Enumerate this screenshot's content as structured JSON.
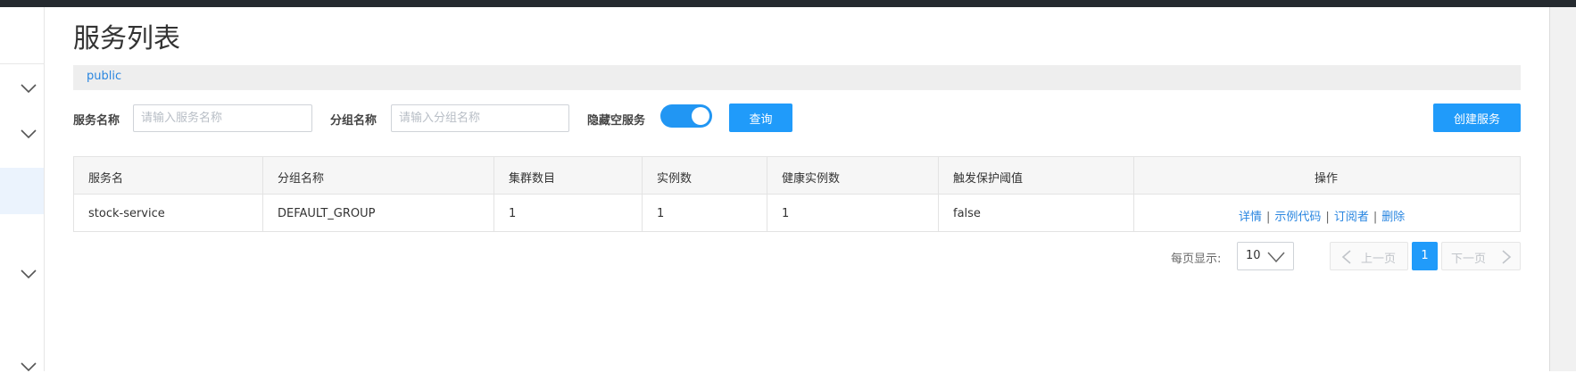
{
  "page": {
    "title": "服务列表"
  },
  "namespace": {
    "label": "public"
  },
  "filters": {
    "service_name_label": "服务名称",
    "service_name_placeholder": "请输入服务名称",
    "group_name_label": "分组名称",
    "group_name_placeholder": "请输入分组名称",
    "hide_empty_label": "隐藏空服务",
    "hide_empty_on": true,
    "query_button": "查询",
    "create_button": "创建服务"
  },
  "table": {
    "headers": [
      "服务名",
      "分组名称",
      "集群数目",
      "实例数",
      "健康实例数",
      "触发保护阈值",
      "操作"
    ],
    "rows": [
      {
        "service_name": "stock-service",
        "group_name": "DEFAULT_GROUP",
        "cluster_count": "1",
        "instance_count": "1",
        "healthy_instance_count": "1",
        "protect_threshold": "false",
        "ops": {
          "detail": "详情",
          "sample_code": "示例代码",
          "subscribers": "订阅者",
          "delete": "删除",
          "separator": "|"
        }
      }
    ]
  },
  "pagination": {
    "page_size_label": "每页显示:",
    "page_size": "10",
    "prev": "上一页",
    "next": "下一页",
    "current_page": "1"
  },
  "colors": {
    "primary": "#209bfa",
    "link": "#2a86e0",
    "topbar": "#252a2f"
  },
  "icons": [
    "chevron-down-icon",
    "chevron-left-icon",
    "chevron-right-icon"
  ]
}
